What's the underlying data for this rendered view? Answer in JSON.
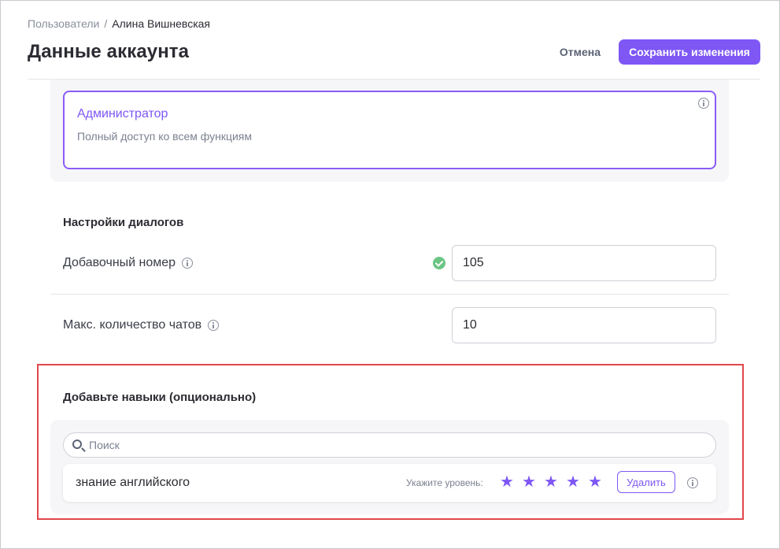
{
  "breadcrumb": {
    "parent": "Пользователи",
    "separator": "/",
    "current": "Алина Вишневская"
  },
  "header": {
    "title": "Данные аккаунта",
    "cancel_label": "Отмена",
    "save_label": "Сохранить изменения"
  },
  "role": {
    "title": "Администратор",
    "description": "Полный доступ ко всем функциям"
  },
  "dialog_settings": {
    "title": "Настройки диалогов",
    "extension_label": "Добавочный номер",
    "extension_value": "105",
    "max_chats_label": "Макс. количество чатов",
    "max_chats_value": "10"
  },
  "skills": {
    "title": "Добавьте навыки (опционально)",
    "search_placeholder": "Поиск",
    "items": [
      {
        "name": "знание английского",
        "level_label": "Укажите уровень:",
        "rating": 5,
        "rating_max": 5,
        "delete_label": "Удалить"
      }
    ]
  },
  "colors": {
    "accent": "#7e57f5",
    "success": "#6cc583",
    "highlight": "#e0474c"
  }
}
